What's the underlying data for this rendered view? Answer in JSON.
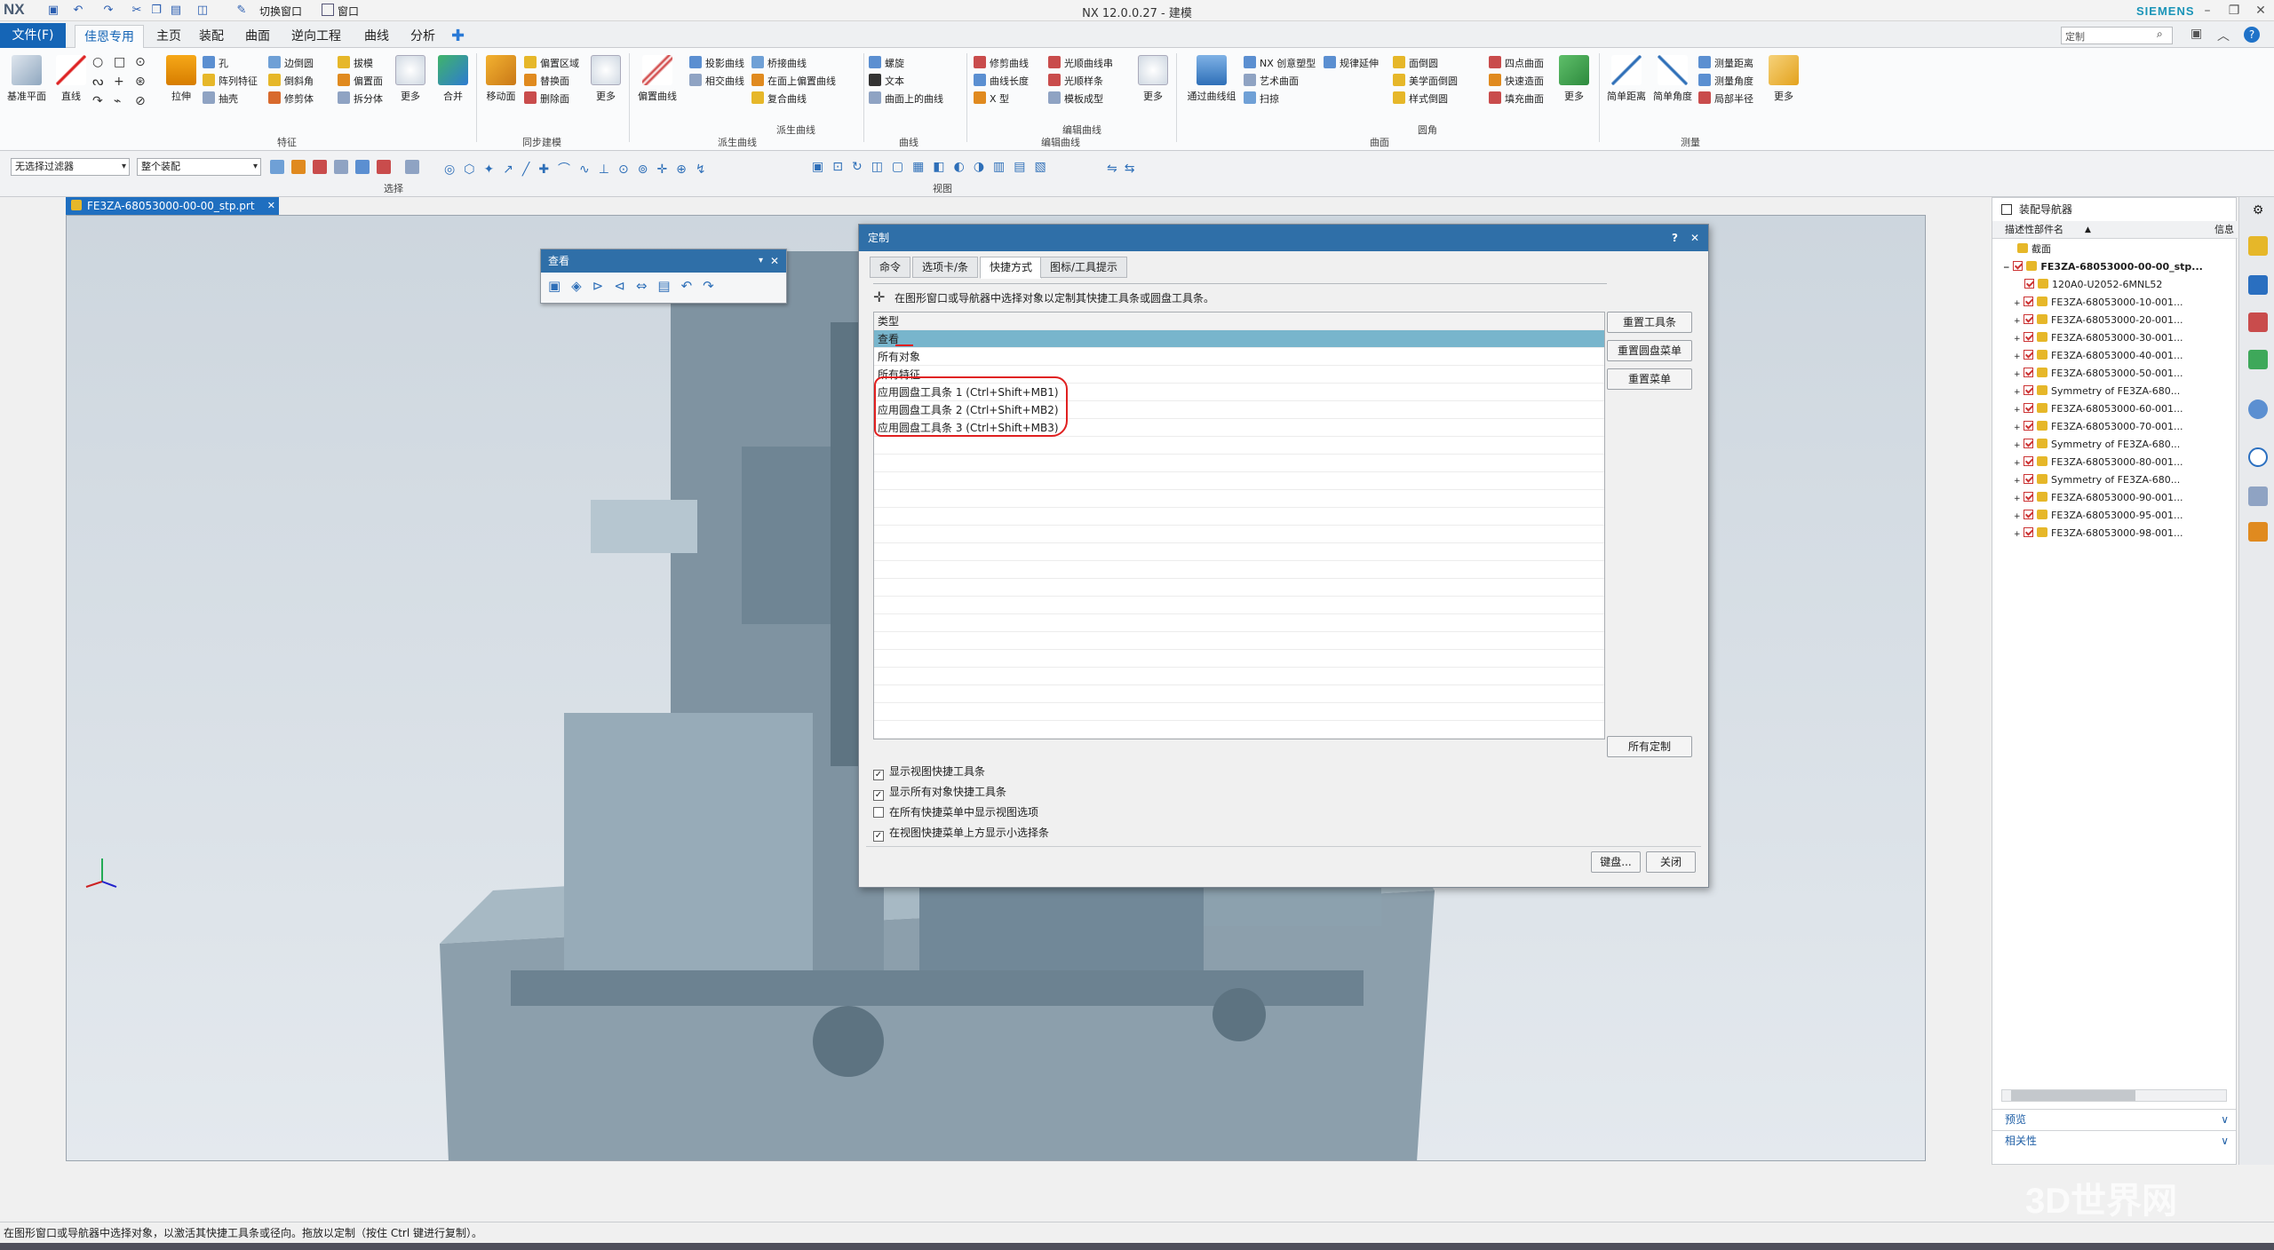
{
  "app": {
    "logo": "NX",
    "title": "NX 12.0.0.27 - 建模",
    "brand": "SIEMENS",
    "switch_window": "切换窗口",
    "window_menu": "窗口"
  },
  "menu": {
    "file": "文件(F)",
    "tabs": [
      "佳恩专用",
      "主页",
      "装配",
      "曲面",
      "逆向工程",
      "曲线",
      "分析"
    ]
  },
  "search": {
    "placeholder": "定制"
  },
  "ribbon": {
    "big": {
      "datum_plane": "基准平面",
      "line": "直线",
      "extrude": "拉伸",
      "more1": "更多",
      "combine": "合并",
      "move_face": "移动面",
      "more2": "更多",
      "offset_curve": "偏置曲线",
      "more3": "更多",
      "through_curves": "通过曲线组",
      "more4": "更多",
      "simple_distance": "简单距离",
      "simple_angle": "简单角度",
      "more5": "更多"
    },
    "small": {
      "hole": "孔",
      "pattern_feature": "阵列特征",
      "draft": "抽壳",
      "edge_blend": "边倒圆",
      "chamfer": "倒斜角",
      "trim_body": "修剪体",
      "draft2": "拔模",
      "offset_face": "偏置面",
      "split_body": "拆分体",
      "offset_region": "偏置区域",
      "replace_face": "替换面",
      "delete_face": "删除面",
      "project_curve": "投影曲线",
      "intersect_curve": "相交曲线",
      "bridge_curve": "桥接曲线",
      "offset_in_face": "在面上偏置曲线",
      "composite_curve": "复合曲线",
      "helix": "螺旋",
      "text": "文本",
      "curve_on_surface": "曲面上的曲线",
      "trim_curve": "修剪曲线",
      "curve_length": "曲线长度",
      "x_form": "X 型",
      "smooth_curve": "光顺曲线串",
      "smooth_spline": "光顺样条",
      "template_forming": "模板成型",
      "nx_creative": "NX 创意塑型",
      "studio_surface": "艺术曲面",
      "sweep": "扫掠",
      "law_extension": "规律延伸",
      "face_blend": "面倒圆",
      "aesthetic_blend": "美学面倒圆",
      "style_blend": "样式倒圆",
      "four_point": "四点曲面",
      "quick_surface": "快速造面",
      "fill_surface": "填充曲面",
      "measure_distance": "测量距离",
      "measure_angle": "测量角度",
      "measure_radius": "局部半径"
    },
    "groups": {
      "feature": "特征",
      "sync": "同步建模",
      "derived": "派生曲线",
      "derived2": "派生曲线",
      "curve": "曲线",
      "edit_curve": "编辑曲线",
      "edit_curve2": "编辑曲线",
      "surface": "曲面",
      "blend": "圆角",
      "measure": "测量"
    }
  },
  "selection": {
    "filter": "无选择过滤器",
    "scope": "整个装配",
    "group": "选择",
    "view_group": "视图"
  },
  "document_tab": "FE3ZA-68053000-00-00_stp.prt",
  "view_toolbar": {
    "title": "查看"
  },
  "dialog": {
    "title": "定制",
    "tabs": [
      "命令",
      "选项卡/条",
      "快捷方式",
      "图标/工具提示"
    ],
    "active_tab": 2,
    "hint": "在图形窗口或导航器中选择对象以定制其快捷工具条或圆盘工具条。",
    "column_header": "类型",
    "rows": [
      "查看",
      "所有对象",
      "所有特征",
      "应用圆盘工具条 1 (Ctrl+Shift+MB1)",
      "应用圆盘工具条 2 (Ctrl+Shift+MB2)",
      "应用圆盘工具条 3 (Ctrl+Shift+MB3)"
    ],
    "selected_row": 0,
    "buttons": {
      "reset_toolbar": "重置工具条",
      "reset_radial": "重置圆盘菜单",
      "reset_menu": "重置菜单",
      "all_custom": "所有定制",
      "keyboard": "键盘...",
      "close": "关闭"
    },
    "checkboxes": [
      {
        "label": "显示视图快捷工具条",
        "checked": true
      },
      {
        "label": "显示所有对象快捷工具条",
        "checked": true
      },
      {
        "label": "在所有快捷菜单中显示视图选项",
        "checked": false
      },
      {
        "label": "在视图快捷菜单上方显示小选择条",
        "checked": true
      }
    ]
  },
  "navigator": {
    "title": "装配导航器",
    "col_name": "描述性部件名",
    "col_info": "信息",
    "section": "截面",
    "root": "FE3ZA-68053000-00-00_stp...",
    "items": [
      "120A0-U2052-6MNL52",
      "FE3ZA-68053000-10-001...",
      "FE3ZA-68053000-20-001...",
      "FE3ZA-68053000-30-001...",
      "FE3ZA-68053000-40-001...",
      "FE3ZA-68053000-50-001...",
      "Symmetry of FE3ZA-680...",
      "FE3ZA-68053000-60-001...",
      "FE3ZA-68053000-70-001...",
      "Symmetry of FE3ZA-680...",
      "FE3ZA-68053000-80-001...",
      "Symmetry of FE3ZA-680...",
      "FE3ZA-68053000-90-001...",
      "FE3ZA-68053000-95-001...",
      "FE3ZA-68053000-98-001..."
    ],
    "preview": "预览",
    "dependencies": "相关性"
  },
  "status": "在图形窗口或导航器中选择对象，以激活其快捷工具条或径向。拖放以定制（按住 Ctrl 键进行复制）。",
  "watermark": "3D世界网",
  "colors": {
    "accent": "#1565b6",
    "dialog_header": "#2f6fa8",
    "annotation": "#e02020"
  }
}
